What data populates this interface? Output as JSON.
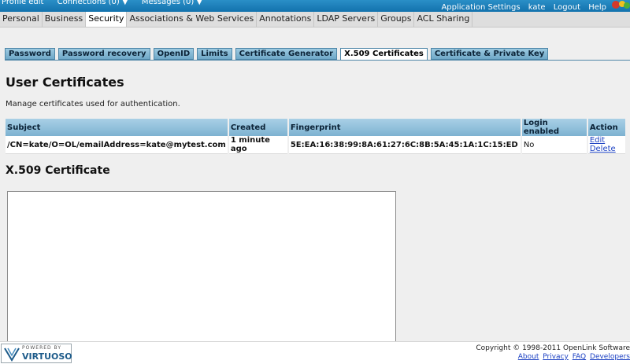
{
  "topbar": {
    "left_items": [
      "Profile edit",
      "Connections (0) ▼",
      "Messages (0) ▼"
    ],
    "right_items": [
      "Application Settings",
      "kate",
      "Logout",
      "Help"
    ]
  },
  "mainnav": {
    "items": [
      {
        "label": "Personal"
      },
      {
        "label": "Business"
      },
      {
        "label": "Security",
        "active": true
      },
      {
        "label": "Associations & Web Services"
      },
      {
        "label": "Annotations"
      },
      {
        "label": "LDAP Servers"
      },
      {
        "label": "Groups"
      },
      {
        "label": "ACL Sharing"
      }
    ]
  },
  "subtabs": {
    "items": [
      {
        "label": "Password"
      },
      {
        "label": "Password recovery"
      },
      {
        "label": "OpenID"
      },
      {
        "label": "Limits"
      },
      {
        "label": "Certificate Generator"
      },
      {
        "label": "X.509 Certificates",
        "active": true
      },
      {
        "label": "Certificate & Private Key"
      }
    ]
  },
  "page": {
    "title": "User Certificates",
    "description": "Manage certificates used for authentication."
  },
  "table": {
    "headers": [
      "Subject",
      "Created",
      "Fingerprint",
      "Login enabled",
      "Action"
    ],
    "rows": [
      {
        "subject": "/CN=kate/O=OL/emailAddress=kate@mytest.com",
        "created": "1 minute ago",
        "fingerprint": "5E:EA:16:38:99:8A:61:27:6C:8B:5A:45:1A:1C:15:ED",
        "login_enabled": "No",
        "edit": "Edit",
        "delete": "Delete"
      }
    ]
  },
  "certificate": {
    "title": "X.509 Certificate",
    "value": ""
  },
  "footer": {
    "powered_by": "POWERED BY",
    "brand": "VIRTUOSO",
    "copyright": "Copyright © 1998-2011 OpenLink Software",
    "links": [
      "About",
      "Privacy",
      "FAQ",
      "Developers"
    ]
  }
}
